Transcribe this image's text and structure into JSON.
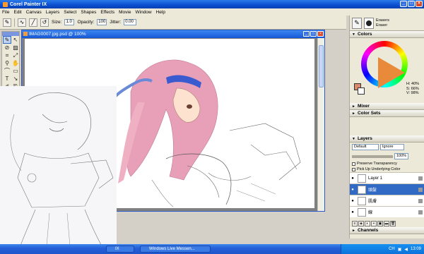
{
  "app": {
    "title": "Corel Painter IX"
  },
  "menu": [
    "File",
    "Edit",
    "Canvas",
    "Layers",
    "Select",
    "Shapes",
    "Effects",
    "Movie",
    "Window",
    "Help"
  ],
  "property_bar": {
    "size_label": "Size:",
    "size_value": "1.0",
    "opacity_label": "Opacity:",
    "opacity_value": "100",
    "jitter_label": "Jitter:",
    "jitter_value": "0.00"
  },
  "document": {
    "title": "IMAG0007.jpg.psd @ 100%"
  },
  "brush_selector": {
    "category": "Erasers",
    "variant": "Eraser"
  },
  "colors_panel": {
    "title": "Colors",
    "h": "H: 40%",
    "s": "S: 66%",
    "v": "V: 98%",
    "primary_color": "#d88a6a",
    "secondary_color": "#ffffff"
  },
  "collapsed_panels": {
    "mixer": "Mixer",
    "color_sets": "Color Sets",
    "channels": "Channels"
  },
  "layers_panel": {
    "title": "Layers",
    "composite_method": "Default",
    "ignore": "Ignore",
    "opacity": "100%",
    "preserve_transparency": "Preserve Transparency",
    "pick_up_color": "Pick Up Underlying Color",
    "layers": [
      {
        "name": "Layer 1",
        "visible": true,
        "active": false
      },
      {
        "name": "頭髮",
        "visible": true,
        "active": true
      },
      {
        "name": "肌膚",
        "visible": true,
        "active": false
      },
      {
        "name": "線",
        "visible": true,
        "active": false
      }
    ]
  },
  "taskbar": {
    "item1": "IX",
    "item2": "Windows Live Messen...",
    "ime": "CH",
    "time": "13:09"
  }
}
